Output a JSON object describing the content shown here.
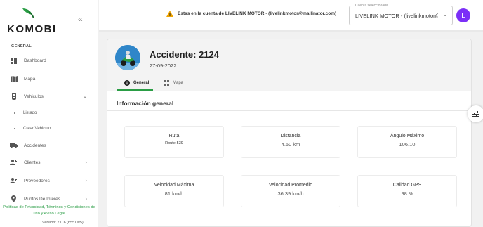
{
  "brand": {
    "name": "KOMOBI",
    "accent": "#2a9d45"
  },
  "sidebar": {
    "section": "GENERAL",
    "items": [
      {
        "label": "Dashboard",
        "icon": "dashboard-icon"
      },
      {
        "label": "Mapa",
        "icon": "map-icon"
      },
      {
        "label": "Vehiculos",
        "icon": "vehicle-icon",
        "expanded": true,
        "children": [
          {
            "label": "Listado"
          },
          {
            "label": "Crear Vehiculo"
          }
        ]
      },
      {
        "label": "Accidentes",
        "icon": "truck-icon"
      },
      {
        "label": "Clientes",
        "icon": "people-icon"
      },
      {
        "label": "Proveedores",
        "icon": "people-icon"
      },
      {
        "label": "Puntos De Interes",
        "icon": "pin-icon"
      }
    ],
    "footer_links": "Politicas de Privacidad, Términos y Condiciones de uso y Aviso Legal",
    "version": "Version: 2.0.6 (b551ef5)"
  },
  "topbar": {
    "warning": "Estas en la cuenta de LIVELINK MOTOR - (livelinkmotor@mailinator.com)",
    "account_select": {
      "legend": "Cuenta seleccionada",
      "value": "LIVELINK MOTOR - (livelinkmotor@mailinator.com)"
    },
    "avatar_letter": "L",
    "avatar_color": "#7b2ff7"
  },
  "accident": {
    "title": "Accidente: 2124",
    "date": "27-09-2022",
    "tabs": [
      {
        "label": "General",
        "icon": "info-icon"
      },
      {
        "label": "Mapa",
        "icon": "map-alt-icon"
      }
    ],
    "section_title": "Información general",
    "stats": [
      {
        "label": "Ruta",
        "value": "Route-539"
      },
      {
        "label": "Distancia",
        "value": "4.50 km"
      },
      {
        "label": "Ángulo Máximo",
        "value": "106.10"
      },
      {
        "label": "Velocidad Máxima",
        "value": "81 km/h"
      },
      {
        "label": "Velocidad Promedio",
        "value": "36.39 km/h"
      },
      {
        "label": "Calidad GPS",
        "value": "98 %"
      }
    ]
  }
}
